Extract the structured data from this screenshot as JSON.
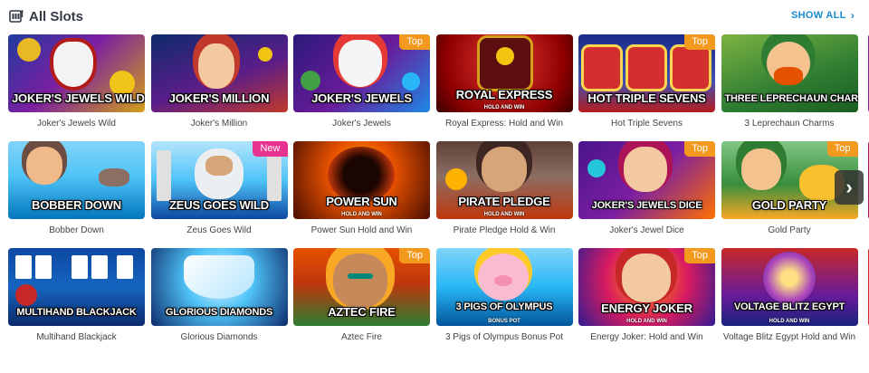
{
  "header": {
    "title": "All Slots",
    "show_all_label": "SHOW ALL",
    "icon": "slots-icon"
  },
  "badges": {
    "top": "Top",
    "new": "New"
  },
  "rows": [
    [
      {
        "name": "Joker's Jewels Wild",
        "logo": "JOKER'S JEWELS WILD",
        "badge": ""
      },
      {
        "name": "Joker's Million",
        "logo": "JOKER'S MILLION",
        "badge": ""
      },
      {
        "name": "Joker's Jewels",
        "logo": "JOKER'S JEWELS",
        "badge": "Top"
      },
      {
        "name": "Royal Express: Hold and Win",
        "logo": "ROYAL EXPRESS",
        "badge": ""
      },
      {
        "name": "Hot Triple Sevens",
        "logo": "HOT TRIPLE SEVENS",
        "badge": "Top"
      },
      {
        "name": "3 Leprechaun Charms",
        "logo": "THREE LEPRECHAUN CHARMS",
        "badge": ""
      }
    ],
    [
      {
        "name": "Bobber Down",
        "logo": "BOBBER DOWN",
        "badge": ""
      },
      {
        "name": "Zeus Goes Wild",
        "logo": "ZEUS GOES WILD",
        "badge": "New"
      },
      {
        "name": "Power Sun Hold and Win",
        "logo": "POWER SUN",
        "badge": ""
      },
      {
        "name": "Pirate Pledge Hold & Win",
        "logo": "PIRATE PLEDGE",
        "badge": ""
      },
      {
        "name": "Joker's Jewel Dice",
        "logo": "JOKER'S JEWELS DICE",
        "badge": "Top"
      },
      {
        "name": "Gold Party",
        "logo": "GOLD PARTY",
        "badge": "Top"
      }
    ],
    [
      {
        "name": "Multihand Blackjack",
        "logo": "MULTIHAND BLACKJACK",
        "badge": ""
      },
      {
        "name": "Glorious Diamonds",
        "logo": "GLORIOUS DIAMONDS",
        "badge": ""
      },
      {
        "name": "Aztec Fire",
        "logo": "AZTEC FIRE",
        "badge": "Top"
      },
      {
        "name": "3 Pigs of Olympus Bonus Pot",
        "logo": "3 PIGS OF OLYMPUS",
        "badge": ""
      },
      {
        "name": "Energy Joker: Hold and Win",
        "logo": "ENERGY JOKER",
        "badge": "Top"
      },
      {
        "name": "Voltage Blitz Egypt Hold and Win",
        "logo": "VOLTAGE BLITZ EGYPT",
        "badge": ""
      }
    ]
  ],
  "logo_subtitles": {
    "royal_express": "HOLD AND WIN",
    "power_sun": "HOLD AND WIN",
    "pirate_pledge": "HOLD AND WIN",
    "three_pigs": "BONUS POT",
    "energy_joker": "HOLD AND WIN",
    "voltage": "HOLD AND WIN"
  },
  "colors": {
    "accent": "#1a8cd0",
    "badge_top": "#f39a1e",
    "badge_new": "#e8328f"
  }
}
